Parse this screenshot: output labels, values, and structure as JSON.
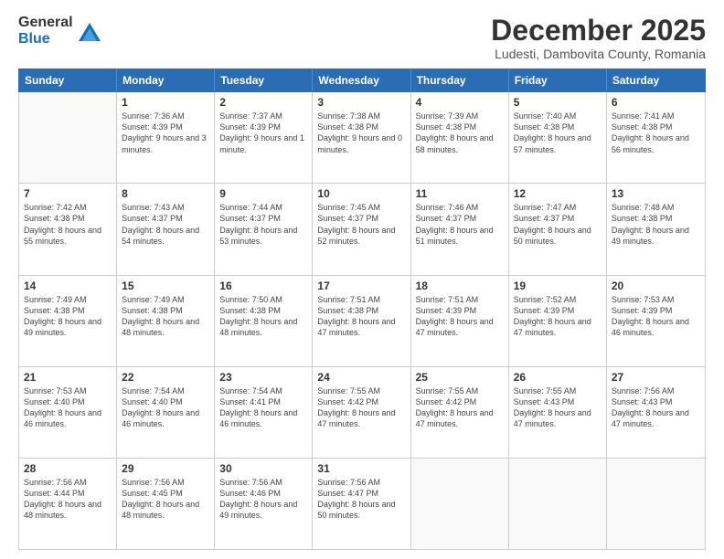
{
  "logo": {
    "general": "General",
    "blue": "Blue"
  },
  "title": "December 2025",
  "location": "Ludesti, Dambovita County, Romania",
  "days": [
    "Sunday",
    "Monday",
    "Tuesday",
    "Wednesday",
    "Thursday",
    "Friday",
    "Saturday"
  ],
  "weeks": [
    [
      {
        "day": "",
        "empty": true
      },
      {
        "day": "1",
        "sunrise": "Sunrise: 7:36 AM",
        "sunset": "Sunset: 4:39 PM",
        "daylight": "Daylight: 9 hours and 3 minutes."
      },
      {
        "day": "2",
        "sunrise": "Sunrise: 7:37 AM",
        "sunset": "Sunset: 4:39 PM",
        "daylight": "Daylight: 9 hours and 1 minute."
      },
      {
        "day": "3",
        "sunrise": "Sunrise: 7:38 AM",
        "sunset": "Sunset: 4:38 PM",
        "daylight": "Daylight: 9 hours and 0 minutes."
      },
      {
        "day": "4",
        "sunrise": "Sunrise: 7:39 AM",
        "sunset": "Sunset: 4:38 PM",
        "daylight": "Daylight: 8 hours and 58 minutes."
      },
      {
        "day": "5",
        "sunrise": "Sunrise: 7:40 AM",
        "sunset": "Sunset: 4:38 PM",
        "daylight": "Daylight: 8 hours and 57 minutes."
      },
      {
        "day": "6",
        "sunrise": "Sunrise: 7:41 AM",
        "sunset": "Sunset: 4:38 PM",
        "daylight": "Daylight: 8 hours and 56 minutes."
      }
    ],
    [
      {
        "day": "7",
        "sunrise": "Sunrise: 7:42 AM",
        "sunset": "Sunset: 4:38 PM",
        "daylight": "Daylight: 8 hours and 55 minutes."
      },
      {
        "day": "8",
        "sunrise": "Sunrise: 7:43 AM",
        "sunset": "Sunset: 4:37 PM",
        "daylight": "Daylight: 8 hours and 54 minutes."
      },
      {
        "day": "9",
        "sunrise": "Sunrise: 7:44 AM",
        "sunset": "Sunset: 4:37 PM",
        "daylight": "Daylight: 8 hours and 53 minutes."
      },
      {
        "day": "10",
        "sunrise": "Sunrise: 7:45 AM",
        "sunset": "Sunset: 4:37 PM",
        "daylight": "Daylight: 8 hours and 52 minutes."
      },
      {
        "day": "11",
        "sunrise": "Sunrise: 7:46 AM",
        "sunset": "Sunset: 4:37 PM",
        "daylight": "Daylight: 8 hours and 51 minutes."
      },
      {
        "day": "12",
        "sunrise": "Sunrise: 7:47 AM",
        "sunset": "Sunset: 4:37 PM",
        "daylight": "Daylight: 8 hours and 50 minutes."
      },
      {
        "day": "13",
        "sunrise": "Sunrise: 7:48 AM",
        "sunset": "Sunset: 4:38 PM",
        "daylight": "Daylight: 8 hours and 49 minutes."
      }
    ],
    [
      {
        "day": "14",
        "sunrise": "Sunrise: 7:49 AM",
        "sunset": "Sunset: 4:38 PM",
        "daylight": "Daylight: 8 hours and 49 minutes."
      },
      {
        "day": "15",
        "sunrise": "Sunrise: 7:49 AM",
        "sunset": "Sunset: 4:38 PM",
        "daylight": "Daylight: 8 hours and 48 minutes."
      },
      {
        "day": "16",
        "sunrise": "Sunrise: 7:50 AM",
        "sunset": "Sunset: 4:38 PM",
        "daylight": "Daylight: 8 hours and 48 minutes."
      },
      {
        "day": "17",
        "sunrise": "Sunrise: 7:51 AM",
        "sunset": "Sunset: 4:38 PM",
        "daylight": "Daylight: 8 hours and 47 minutes."
      },
      {
        "day": "18",
        "sunrise": "Sunrise: 7:51 AM",
        "sunset": "Sunset: 4:39 PM",
        "daylight": "Daylight: 8 hours and 47 minutes."
      },
      {
        "day": "19",
        "sunrise": "Sunrise: 7:52 AM",
        "sunset": "Sunset: 4:39 PM",
        "daylight": "Daylight: 8 hours and 47 minutes."
      },
      {
        "day": "20",
        "sunrise": "Sunrise: 7:53 AM",
        "sunset": "Sunset: 4:39 PM",
        "daylight": "Daylight: 8 hours and 46 minutes."
      }
    ],
    [
      {
        "day": "21",
        "sunrise": "Sunrise: 7:53 AM",
        "sunset": "Sunset: 4:40 PM",
        "daylight": "Daylight: 8 hours and 46 minutes."
      },
      {
        "day": "22",
        "sunrise": "Sunrise: 7:54 AM",
        "sunset": "Sunset: 4:40 PM",
        "daylight": "Daylight: 8 hours and 46 minutes."
      },
      {
        "day": "23",
        "sunrise": "Sunrise: 7:54 AM",
        "sunset": "Sunset: 4:41 PM",
        "daylight": "Daylight: 8 hours and 46 minutes."
      },
      {
        "day": "24",
        "sunrise": "Sunrise: 7:55 AM",
        "sunset": "Sunset: 4:42 PM",
        "daylight": "Daylight: 8 hours and 47 minutes."
      },
      {
        "day": "25",
        "sunrise": "Sunrise: 7:55 AM",
        "sunset": "Sunset: 4:42 PM",
        "daylight": "Daylight: 8 hours and 47 minutes."
      },
      {
        "day": "26",
        "sunrise": "Sunrise: 7:55 AM",
        "sunset": "Sunset: 4:43 PM",
        "daylight": "Daylight: 8 hours and 47 minutes."
      },
      {
        "day": "27",
        "sunrise": "Sunrise: 7:56 AM",
        "sunset": "Sunset: 4:43 PM",
        "daylight": "Daylight: 8 hours and 47 minutes."
      }
    ],
    [
      {
        "day": "28",
        "sunrise": "Sunrise: 7:56 AM",
        "sunset": "Sunset: 4:44 PM",
        "daylight": "Daylight: 8 hours and 48 minutes."
      },
      {
        "day": "29",
        "sunrise": "Sunrise: 7:56 AM",
        "sunset": "Sunset: 4:45 PM",
        "daylight": "Daylight: 8 hours and 48 minutes."
      },
      {
        "day": "30",
        "sunrise": "Sunrise: 7:56 AM",
        "sunset": "Sunset: 4:46 PM",
        "daylight": "Daylight: 8 hours and 49 minutes."
      },
      {
        "day": "31",
        "sunrise": "Sunrise: 7:56 AM",
        "sunset": "Sunset: 4:47 PM",
        "daylight": "Daylight: 8 hours and 50 minutes."
      },
      {
        "day": "",
        "empty": true
      },
      {
        "day": "",
        "empty": true
      },
      {
        "day": "",
        "empty": true
      }
    ]
  ]
}
